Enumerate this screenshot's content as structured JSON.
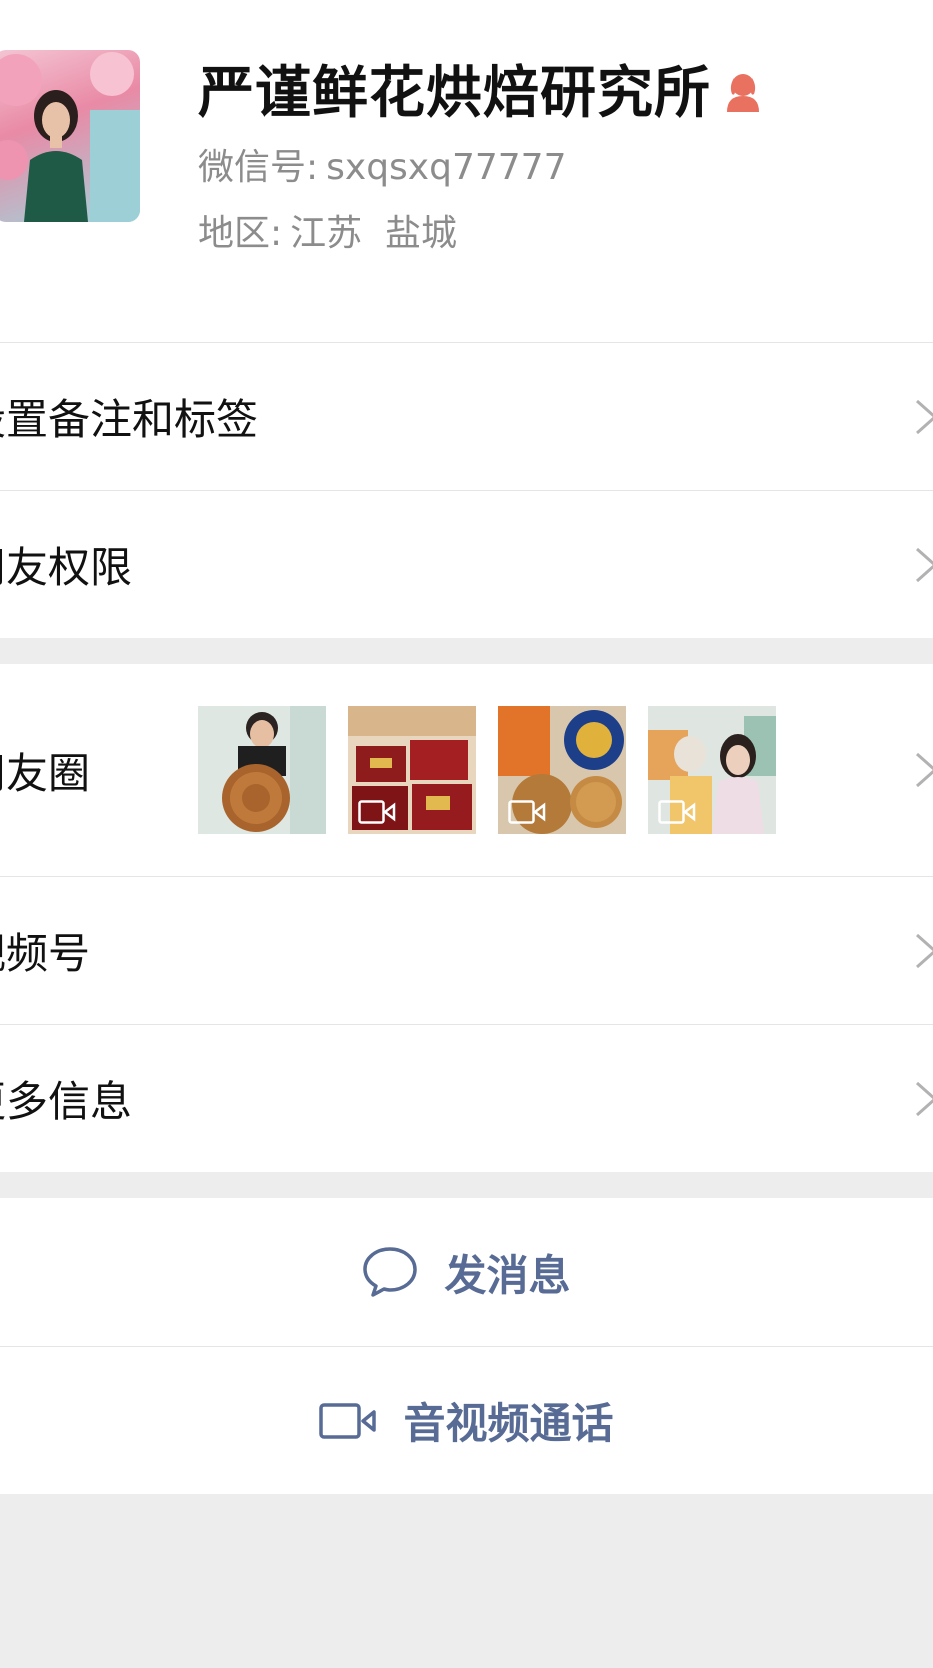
{
  "profile": {
    "name": "严谨鲜花烘焙研究所",
    "wechat_id_label": "微信号:",
    "wechat_id": "sxqsxq77777",
    "region_label": "地区:",
    "region": "江苏  盐城",
    "gender_icon": "female-icon",
    "gender_color": "#e9715f"
  },
  "settings": {
    "items": [
      {
        "label": "设置备注和标签"
      },
      {
        "label": "朋友权限"
      }
    ]
  },
  "info": {
    "moments_label": "朋友圈",
    "moments_thumbnails": [
      {
        "desc": "child-holding-mooncake-photo",
        "video": false
      },
      {
        "desc": "mooncake-gift-boxes-video",
        "video": true
      },
      {
        "desc": "mooncake-tin-video",
        "video": true
      },
      {
        "desc": "woman-holding-box-video",
        "video": true
      }
    ],
    "channels_label": "视频号",
    "more_label": "更多信息"
  },
  "actions": {
    "message_label": "发消息",
    "call_label": "音视频通话",
    "accent_color": "#576b95"
  }
}
